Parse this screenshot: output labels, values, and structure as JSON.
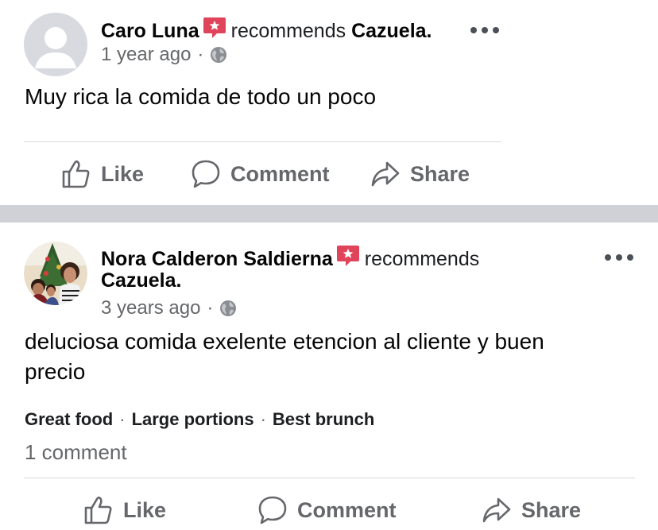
{
  "post1": {
    "author": "Caro Luna",
    "action_text": "recommends",
    "page_name": "Cazuela.",
    "time": "1 year ago",
    "body": "Muy rica la comida  de todo un poco",
    "actions": {
      "like": "Like",
      "comment": "Comment",
      "share": "Share"
    }
  },
  "post2": {
    "author": "Nora Calderon Saldierna",
    "action_text": "recommends",
    "page_name": "Cazuela.",
    "time": "3 years ago",
    "body_line1": "deluciosa comida exelente etencion al cliente y buen",
    "body_line2": "precio",
    "tags": [
      "Great food",
      "Large portions",
      "Best brunch"
    ],
    "comment_count": "1 comment",
    "actions": {
      "like": "Like",
      "comment": "Comment",
      "share": "Share"
    }
  },
  "colors": {
    "recommend_badge": "#e0445a",
    "secondary_text": "#65676b",
    "separator": "#cfd1d6"
  }
}
